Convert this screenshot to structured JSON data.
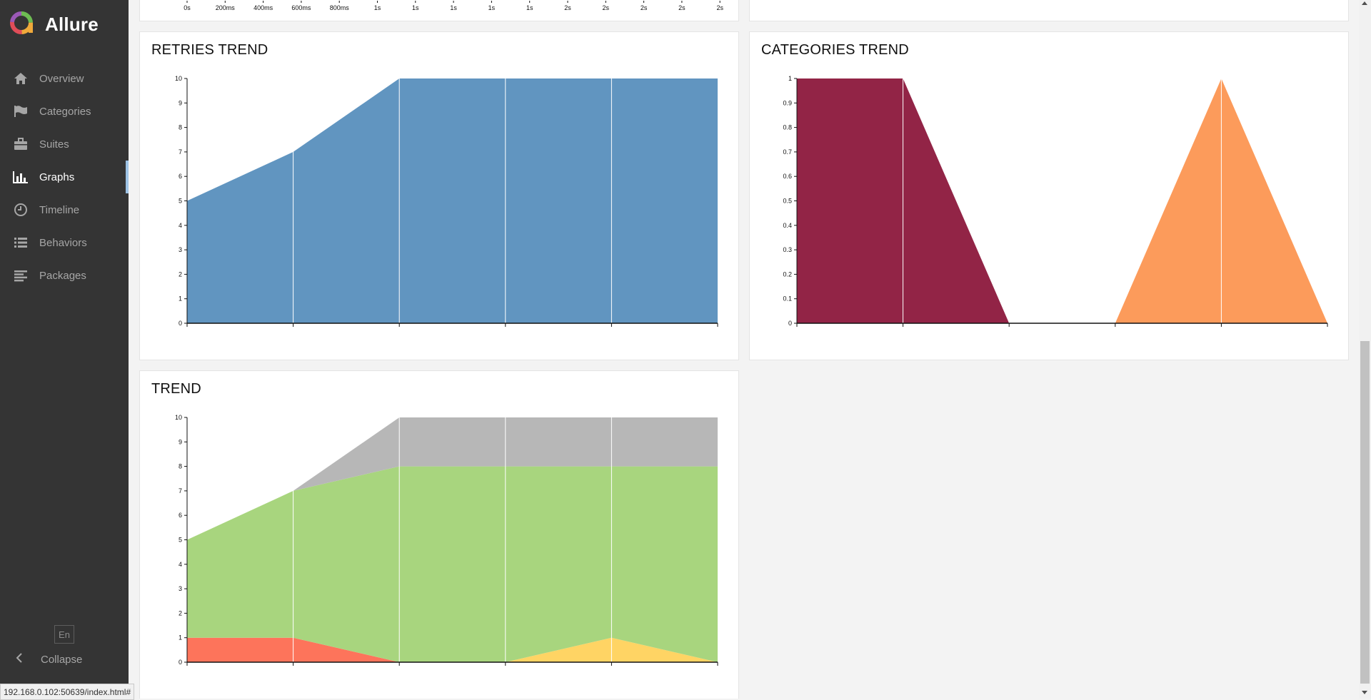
{
  "app": {
    "title": "Allure"
  },
  "sidebar": {
    "items": [
      {
        "label": "Overview",
        "icon": "home-icon",
        "active": false
      },
      {
        "label": "Categories",
        "icon": "flag-icon",
        "active": false
      },
      {
        "label": "Suites",
        "icon": "briefcase-icon",
        "active": false
      },
      {
        "label": "Graphs",
        "icon": "bar-chart-icon",
        "active": true
      },
      {
        "label": "Timeline",
        "icon": "clock-icon",
        "active": false
      },
      {
        "label": "Behaviors",
        "icon": "list-icon",
        "active": false
      },
      {
        "label": "Packages",
        "icon": "align-left-icon",
        "active": false
      }
    ],
    "language": "En",
    "collapse_label": "Collapse"
  },
  "top_partial_axis": {
    "tick_labels": [
      "0s",
      "200ms",
      "400ms",
      "600ms",
      "800ms",
      "1s",
      "1s",
      "1s",
      "1s",
      "1s",
      "2s",
      "2s",
      "2s",
      "2s",
      "2s"
    ]
  },
  "cards": {
    "retries_title": "RETRIES TREND",
    "categories_title": "CATEGORIES TREND",
    "trend_title": "TREND"
  },
  "status_url": "192.168.0.102:50639/index.html#",
  "colors": {
    "sidebar_bg": "#343434",
    "active_marker": "#9ec3e6",
    "retries": "#6195c0",
    "product_defects": "#922446",
    "test_defects": "#fc9b5b",
    "failed": "#fd745b",
    "broken": "#ffd464",
    "passed": "#a8d57e",
    "unknown": "#b7b7b7"
  },
  "chart_data": [
    {
      "type": "area",
      "title": "RETRIES TREND",
      "x": [
        1,
        2,
        3,
        4,
        5,
        6
      ],
      "ylim": [
        0,
        10
      ],
      "yticks": [
        0,
        1,
        2,
        3,
        4,
        5,
        6,
        7,
        8,
        9,
        10
      ],
      "series": [
        {
          "values": [
            5,
            7,
            10,
            10,
            10,
            10
          ],
          "color": "#6195c0"
        }
      ],
      "grid": true
    },
    {
      "type": "area",
      "title": "CATEGORIES TREND",
      "x": [
        1,
        2,
        3,
        4,
        5,
        6
      ],
      "ylim": [
        0,
        1
      ],
      "yticks": [
        0,
        0.1,
        0.2,
        0.3,
        0.4,
        0.5,
        0.6,
        0.7,
        0.8,
        0.9,
        1
      ],
      "series": [
        {
          "values": [
            1,
            1,
            0,
            0,
            0,
            0
          ],
          "color": "#922446"
        },
        {
          "values": [
            0,
            0,
            0,
            0,
            1,
            0
          ],
          "color": "#fc9b5b"
        }
      ],
      "stacked": true,
      "grid": true
    },
    {
      "type": "area",
      "title": "TREND",
      "x": [
        1,
        2,
        3,
        4,
        5,
        6
      ],
      "ylim": [
        0,
        10
      ],
      "yticks": [
        0,
        1,
        2,
        3,
        4,
        5,
        6,
        7,
        8,
        9,
        10
      ],
      "stacked": true,
      "series": [
        {
          "values": [
            1,
            1,
            0,
            0,
            0,
            0
          ],
          "color": "#fd745b"
        },
        {
          "values": [
            0,
            0,
            0,
            0,
            1,
            0
          ],
          "color": "#ffd464"
        },
        {
          "values": [
            4,
            6,
            8,
            8,
            7,
            8
          ],
          "color": "#a8d57e"
        },
        {
          "values": [
            0,
            0,
            0,
            0,
            0,
            0
          ],
          "color": "#d35ebe"
        },
        {
          "values": [
            0,
            0,
            2,
            2,
            2,
            2
          ],
          "color": "#b7b7b7"
        }
      ],
      "grid": true
    }
  ]
}
